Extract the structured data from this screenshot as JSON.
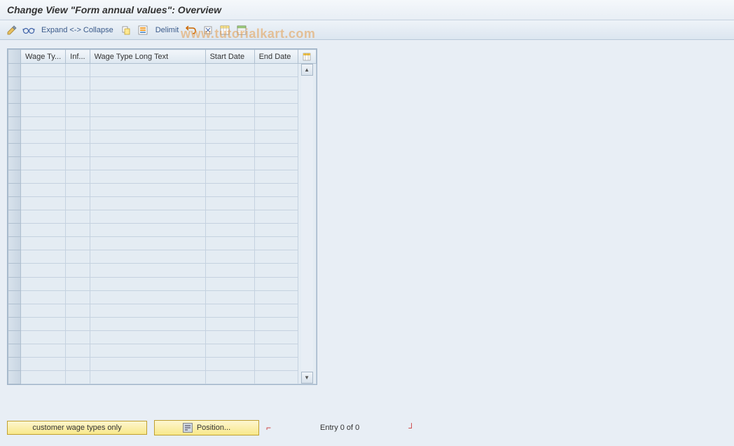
{
  "header": {
    "title": "Change View \"Form annual values\": Overview"
  },
  "toolbar": {
    "expand_collapse": "Expand <-> Collapse",
    "delimit": "Delimit",
    "icons": {
      "change": "change-icon",
      "glasses": "glasses-icon",
      "copy": "copy-icon",
      "select_all": "select-all-icon",
      "undo": "undo-icon",
      "cut": "cut-icon",
      "table_settings": "table-settings-icon",
      "variant": "variant-icon"
    }
  },
  "table": {
    "columns": [
      "Wage Ty...",
      "Inf...",
      "Wage Type Long Text",
      "Start Date",
      "End Date"
    ],
    "row_count": 24,
    "rows": []
  },
  "footer": {
    "customer_button": "customer wage types only",
    "position_button": "Position...",
    "entry_text": "Entry 0 of 0"
  },
  "watermark": "www.tutorialkart.com"
}
